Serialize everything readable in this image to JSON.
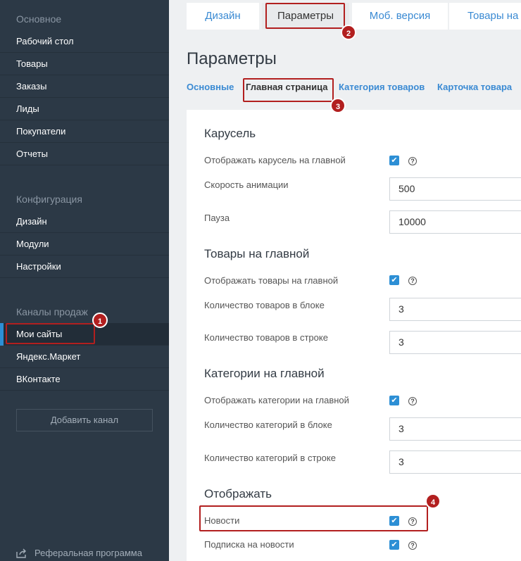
{
  "sidebar": {
    "section_main": "Основное",
    "main_items": [
      "Рабочий стол",
      "Товары",
      "Заказы",
      "Лиды",
      "Покупатели",
      "Отчеты"
    ],
    "section_config": "Конфигурация",
    "config_items": [
      "Дизайн",
      "Модули",
      "Настройки"
    ],
    "section_channels": "Каналы продаж",
    "channel_items": [
      "Мои сайты",
      "Яндекс.Маркет",
      "ВКонтакте"
    ],
    "add_channel": "Добавить канал",
    "referral": "Реферальная программа"
  },
  "tabs": [
    "Дизайн",
    "Параметры",
    "Моб. версия",
    "Товары на гл"
  ],
  "page_title": "Параметры",
  "subtabs": [
    "Основные",
    "Главная страница",
    "Категория товаров",
    "Карточка товара"
  ],
  "sections": {
    "carousel": {
      "title": "Карусель",
      "show_label": "Отображать карусель на главной",
      "speed_label": "Скорость анимации",
      "speed_value": "500",
      "pause_label": "Пауза",
      "pause_value": "10000"
    },
    "products": {
      "title": "Товары на главной",
      "show_label": "Отображать товары на главной",
      "count_block_label": "Количество товаров в блоке",
      "count_block_value": "3",
      "count_row_label": "Количество товаров в строке",
      "count_row_value": "3"
    },
    "categories": {
      "title": "Категории на главной",
      "show_label": "Отображать категории на главной",
      "count_block_label": "Количество категорий в блоке",
      "count_block_value": "3",
      "count_row_label": "Количество категорий в строке",
      "count_row_value": "3"
    },
    "display": {
      "title": "Отображать",
      "news_label": "Новости",
      "subscribe_label": "Подписка на новости"
    }
  },
  "icons": {
    "check": "✔",
    "help": "?"
  },
  "badges": [
    "1",
    "2",
    "3",
    "4"
  ],
  "colors": {
    "sidebar": "#2c3946",
    "accent": "#2d8fd5",
    "annotation": "#b21f1f"
  }
}
